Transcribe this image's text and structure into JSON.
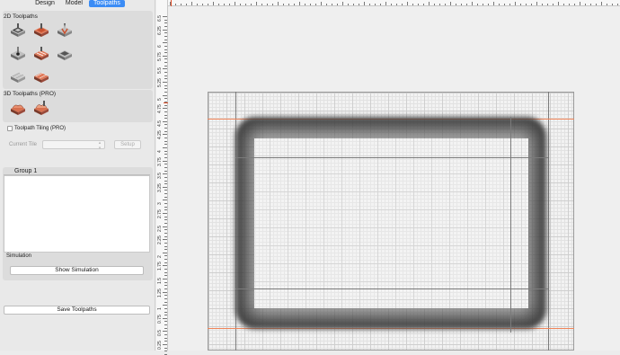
{
  "tabs": [
    {
      "label": "Design",
      "active": false
    },
    {
      "label": "Model",
      "active": false
    },
    {
      "label": "Toolpaths",
      "active": true
    }
  ],
  "toolpaths_2d": {
    "title": "2D Toolpaths",
    "tools": [
      "profile-toolpath-icon",
      "pocket-toolpath-icon",
      "vcarve-toolpath-icon",
      "drilling-toolpath-icon",
      "fluting-toolpath-icon",
      "chamfer-toolpath-icon",
      "texture-toolpath-icon",
      "inlay-toolpath-icon"
    ]
  },
  "toolpaths_3d": {
    "title": "3D Toolpaths (PRO)",
    "tools": [
      "3d-roughing-icon",
      "3d-finishing-icon"
    ]
  },
  "tiling": {
    "label": "Toolpath Tiling (PRO)",
    "current_tile_label": "Current Tile",
    "setup_label": "Setup"
  },
  "group": {
    "header": "Group 1",
    "simulation_label": "Simulation",
    "show_simulation_label": "Show Simulation"
  },
  "save_toolpaths_label": "Save Toolpaths",
  "ruler": {
    "vertical_labels": [
      "6.5",
      "6.25",
      "6",
      "5.75",
      "5.5",
      "5.25",
      "5",
      "4.75",
      "4.5",
      "4.25",
      "4",
      "3.75",
      "3.5",
      "3.25",
      "3",
      "2.75",
      "2.5",
      "2.25",
      "2",
      "1.75",
      "1.5",
      "1.25",
      "1",
      "0.75",
      "0.5",
      "0.25"
    ]
  },
  "colors": {
    "accent": "#3b8cf5",
    "margin_line": "#f0855a",
    "ruler_marker": "#e0502a"
  }
}
